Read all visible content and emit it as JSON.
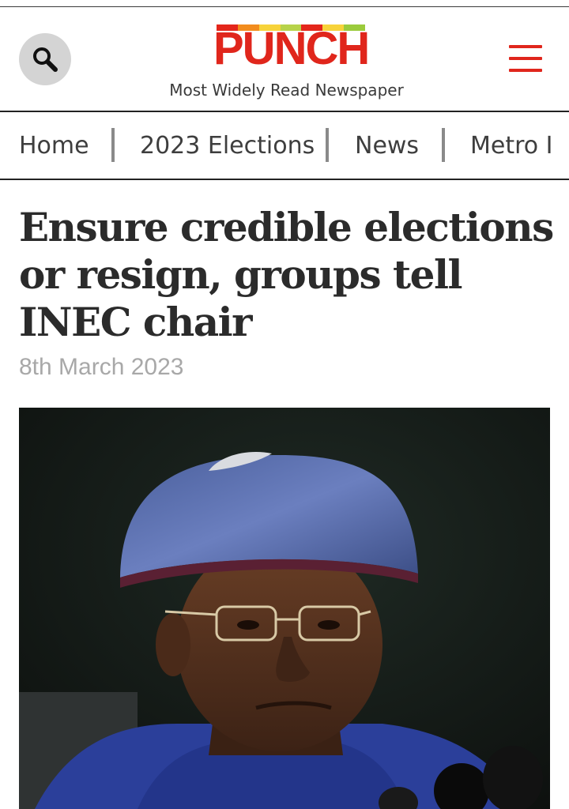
{
  "header": {
    "logo_text": "PUNCH",
    "tagline": "Most Widely Read Newspaper",
    "search_icon": "search-icon",
    "menu_icon": "hamburger-menu-icon",
    "brand_color": "#e0261c"
  },
  "nav": {
    "items": [
      {
        "label": "Home"
      },
      {
        "label": "2023 Elections"
      },
      {
        "label": "News"
      },
      {
        "label": "Metro I"
      }
    ]
  },
  "article": {
    "headline": "Ensure credible elections or resign, groups tell INEC chair",
    "date": "8th March 2023"
  }
}
